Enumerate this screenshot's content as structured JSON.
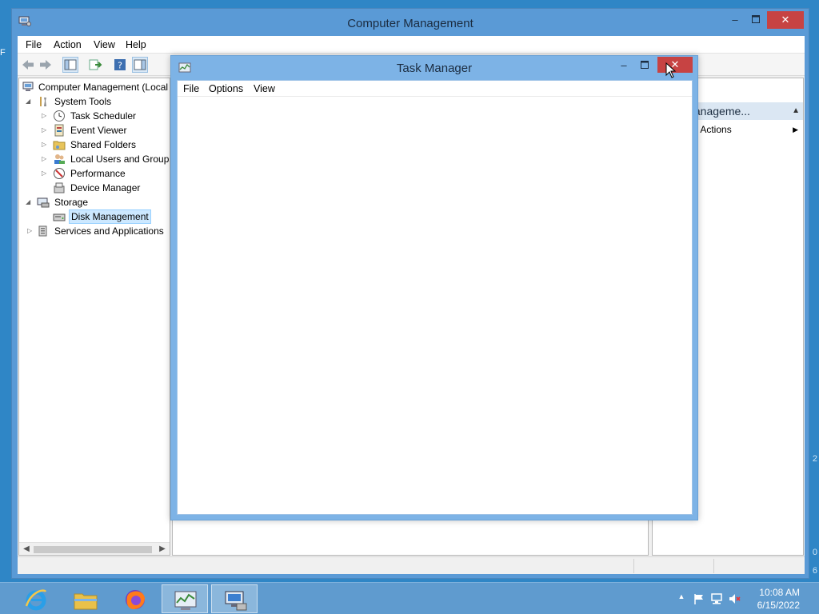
{
  "desktop": {
    "left_glyph": "F",
    "right_glyph_a": "0",
    "right_glyph_b": "6",
    "right_glyph_c": "2"
  },
  "computer_management": {
    "title": "Computer Management",
    "menu": [
      "File",
      "Action",
      "View",
      "Help"
    ],
    "tree": [
      {
        "label": "Computer Management (Local",
        "icon": "computer-management-icon",
        "expander": ""
      },
      {
        "label": "System Tools",
        "icon": "system-tools-icon",
        "expander": "◢"
      },
      {
        "label": "Task Scheduler",
        "icon": "clock-icon",
        "expander": "▷"
      },
      {
        "label": "Event Viewer",
        "icon": "event-viewer-icon",
        "expander": "▷"
      },
      {
        "label": "Shared Folders",
        "icon": "shared-folder-icon",
        "expander": "▷"
      },
      {
        "label": "Local Users and Groups",
        "icon": "users-icon",
        "expander": "▷"
      },
      {
        "label": "Performance",
        "icon": "performance-icon",
        "expander": "▷"
      },
      {
        "label": "Device Manager",
        "icon": "device-manager-icon",
        "expander": ""
      },
      {
        "label": "Storage",
        "icon": "storage-icon",
        "expander": "◢"
      },
      {
        "label": "Disk Management",
        "icon": "disk-icon",
        "expander": ""
      },
      {
        "label": "Services and Applications",
        "icon": "services-icon",
        "expander": "▷"
      }
    ],
    "selected_tree_item": "Disk Management",
    "actions": {
      "header": "ter Manageme...",
      "more_actions": "e Actions"
    }
  },
  "task_manager": {
    "title": "Task Manager",
    "menu": [
      "File",
      "Options",
      "View"
    ]
  },
  "taskbar": {
    "apps": [
      "internet-explorer-icon",
      "file-explorer-icon",
      "firefox-icon",
      "task-manager-icon",
      "computer-management-icon"
    ],
    "active_apps": [
      "task-manager-icon",
      "computer-management-icon"
    ],
    "clock": {
      "time": "10:08 AM",
      "date": "6/15/2022"
    },
    "tray": {
      "show_hidden": "▲"
    }
  },
  "colors": {
    "desktop": "#2f86c6",
    "titlebar_active": "#5a9ad6",
    "close_button": "#c74343",
    "selection": "#cce8ff",
    "taskbar": "#5f9bcf"
  }
}
